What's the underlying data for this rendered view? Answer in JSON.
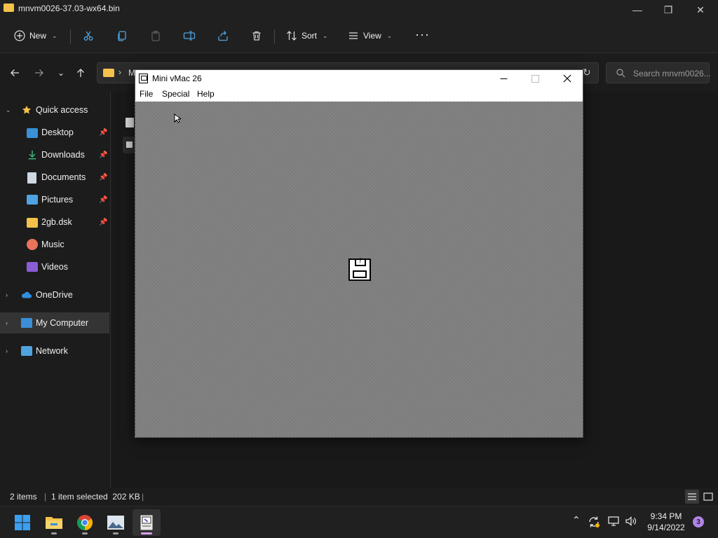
{
  "window": {
    "title": "mnvm0026-37.03-wx64.bin",
    "controls": {
      "minimize": "—",
      "restore": "❐",
      "close": "✕"
    }
  },
  "toolbar": {
    "new_label": "New",
    "sort_label": "Sort",
    "view_label": "View",
    "more_label": "···",
    "icons": [
      "cut-icon",
      "copy-icon",
      "paste-icon",
      "rename-icon",
      "share-icon",
      "delete-icon"
    ]
  },
  "address": {
    "search_placeholder": "Search mnvm0026...",
    "crumb_initial": "M"
  },
  "sidebar": {
    "items": [
      {
        "label": "Quick access",
        "icon": "star-icon",
        "pinned": false
      },
      {
        "label": "Desktop",
        "icon": "desktop-icon",
        "pinned": true
      },
      {
        "label": "Downloads",
        "icon": "download-icon",
        "pinned": true
      },
      {
        "label": "Documents",
        "icon": "documents-icon",
        "pinned": true
      },
      {
        "label": "Pictures",
        "icon": "pictures-icon",
        "pinned": true
      },
      {
        "label": "2gb.dsk",
        "icon": "folder-icon",
        "pinned": true
      },
      {
        "label": "Music",
        "icon": "music-icon",
        "pinned": false
      },
      {
        "label": "Videos",
        "icon": "videos-icon",
        "pinned": false
      },
      {
        "label": "OneDrive",
        "icon": "cloud-icon",
        "pinned": false
      },
      {
        "label": "My Computer",
        "icon": "computer-icon",
        "pinned": false,
        "selected": true
      },
      {
        "label": "Network",
        "icon": "network-icon",
        "pinned": false
      }
    ]
  },
  "status": {
    "item_count": "2 items",
    "selection": "1 item selected  202 KB"
  },
  "vmac": {
    "title": "Mini vMac 26",
    "menus": [
      "File",
      "Special",
      "Help"
    ],
    "disk_glyph": "?"
  },
  "taskbar": {
    "time": "9:34 PM",
    "date": "9/14/2022",
    "notifications": "3",
    "apps": [
      "start-icon",
      "file-explorer-icon",
      "chrome-icon",
      "image-viewer-icon",
      "mini-vmac-icon"
    ]
  },
  "colors": {
    "accent": "#f4c24a",
    "selected_bg": "#343434",
    "notif_badge": "#b084e6"
  }
}
